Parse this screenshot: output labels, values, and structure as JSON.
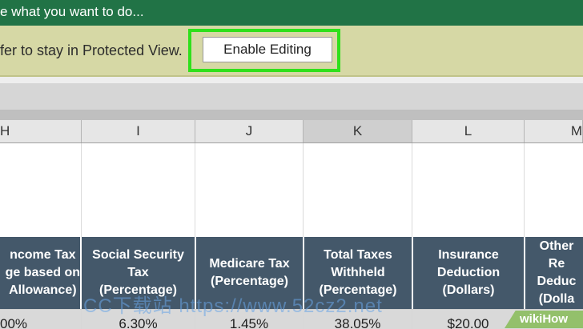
{
  "titlebar": {
    "tell_me": "e what you want to do..."
  },
  "protected_view": {
    "message": "fer to stay in Protected View.",
    "enable_editing_label": "Enable Editing"
  },
  "column_headers": [
    "H",
    "I",
    "J",
    "K",
    "L",
    "M"
  ],
  "table": {
    "headers": [
      "ncome Tax\nge based on\nAllowance)",
      "Social Security\nTax\n(Percentage)",
      "Medicare Tax\n(Percentage)",
      "Total Taxes\nWithheld\n(Percentage)",
      "Insurance\nDeduction\n(Dollars)",
      "Other Re\nDeduc\n(Dolla"
    ],
    "values": [
      "00%",
      "6.30%",
      "1.45%",
      "38.05%",
      "$20.00",
      ""
    ]
  },
  "watermark_text": "CC下载站 https://www.52cz2.net",
  "badge_text": "wikiHow",
  "colors": {
    "title_green": "#217346",
    "protected_bar": "#d6d8a5",
    "highlight": "#2fe01b",
    "table_header": "#44586a"
  }
}
